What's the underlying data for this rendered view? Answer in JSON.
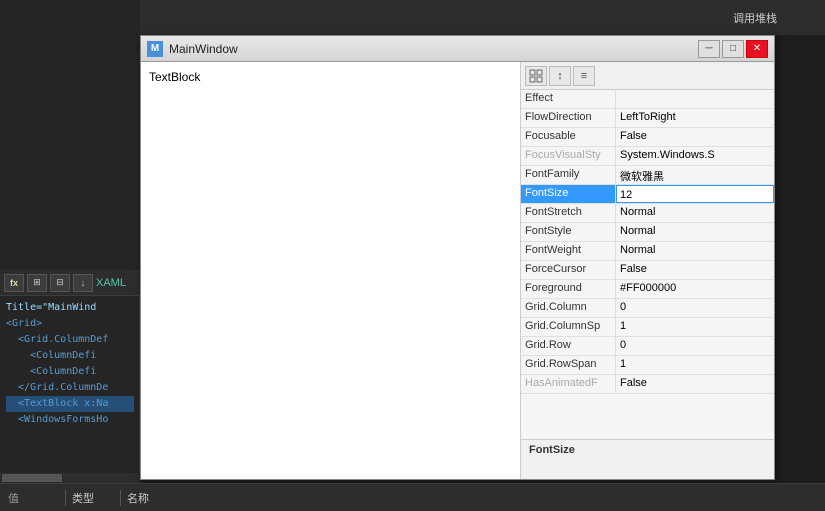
{
  "window": {
    "title": "MainWindow",
    "icon_label": "M"
  },
  "title_bar_buttons": {
    "minimize": "─",
    "maximize": "□",
    "close": "✕"
  },
  "preview": {
    "textblock_label": "TextBlock"
  },
  "props_toolbar": {
    "btn1": "⊞",
    "btn2": "↕",
    "btn3": "≡"
  },
  "properties": [
    {
      "name": "Effect",
      "value": "",
      "grayed": false
    },
    {
      "name": "FlowDirection",
      "value": "LeftToRight",
      "grayed": false
    },
    {
      "name": "Focusable",
      "value": "False",
      "grayed": false
    },
    {
      "name": "FocusVisualSty",
      "value": "System.Windows.S",
      "grayed": true
    },
    {
      "name": "FontFamily",
      "value": "微软雅黑",
      "grayed": false
    },
    {
      "name": "FontSize",
      "value": "12",
      "grayed": false,
      "selected": true,
      "editing": true
    },
    {
      "name": "FontStretch",
      "value": "Normal",
      "grayed": false
    },
    {
      "name": "FontStyle",
      "value": "Normal",
      "grayed": false
    },
    {
      "name": "FontWeight",
      "value": "Normal",
      "grayed": false
    },
    {
      "name": "ForceCursor",
      "value": "False",
      "grayed": false
    },
    {
      "name": "Foreground",
      "value": "#FF000000",
      "grayed": false
    },
    {
      "name": "Grid.Column",
      "value": "0",
      "grayed": false
    },
    {
      "name": "Grid.ColumnSp",
      "value": "1",
      "grayed": false
    },
    {
      "name": "Grid.Row",
      "value": "0",
      "grayed": false
    },
    {
      "name": "Grid.RowSpan",
      "value": "1",
      "grayed": false
    },
    {
      "name": "HasAnimatedF",
      "value": "False",
      "grayed": true
    }
  ],
  "description": {
    "label": "FontSize"
  },
  "code_toolbar": {
    "btn_fx": "fx",
    "btn_grid": "⊞",
    "btn_split": "⊟",
    "btn_arrow": "↓",
    "label": "XAML"
  },
  "code_lines": [
    {
      "text": "Title=\"MainWind",
      "indent": 0,
      "type": "attr"
    },
    {
      "text": "<Grid>",
      "indent": 0,
      "type": "tag"
    },
    {
      "text": "<Grid.ColumnDef",
      "indent": 1,
      "type": "tag"
    },
    {
      "text": "<ColumnDefi",
      "indent": 2,
      "type": "tag"
    },
    {
      "text": "<ColumnDefi",
      "indent": 2,
      "type": "tag"
    },
    {
      "text": "</Grid.ColumnDe",
      "indent": 1,
      "type": "tag"
    },
    {
      "text": "<TextBlock x:Na",
      "indent": 1,
      "type": "tag",
      "highlighted": true
    },
    {
      "text": "<WindowsFormsHo",
      "indent": 1,
      "type": "tag"
    }
  ],
  "bottom_bar": {
    "label1": "值",
    "label2": "类型",
    "label3": "名称",
    "callstack_label": "调用堆栈"
  },
  "scrollbar": {
    "position": 0.3
  }
}
